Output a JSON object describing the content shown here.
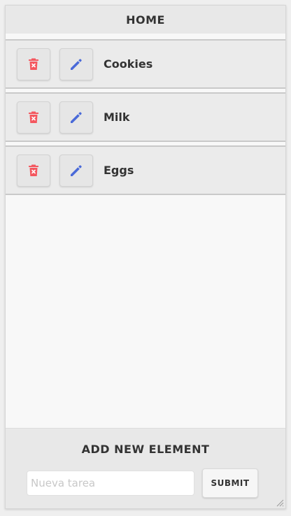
{
  "header": {
    "title": "HOME"
  },
  "items": [
    {
      "label": "Cookies",
      "delete_icon": "trash-x-icon",
      "edit_icon": "pencil-icon"
    },
    {
      "label": "Milk",
      "delete_icon": "trash-x-icon",
      "edit_icon": "pencil-icon"
    },
    {
      "label": "Eggs",
      "delete_icon": "trash-x-icon",
      "edit_icon": "pencil-icon"
    }
  ],
  "footer": {
    "title": "ADD NEW ELEMENT",
    "input_value": "",
    "input_placeholder": "Nueva tarea",
    "submit_label": "SUBMIT"
  },
  "colors": {
    "delete_icon": "#f4575f",
    "edit_icon": "#4a6ad8"
  }
}
